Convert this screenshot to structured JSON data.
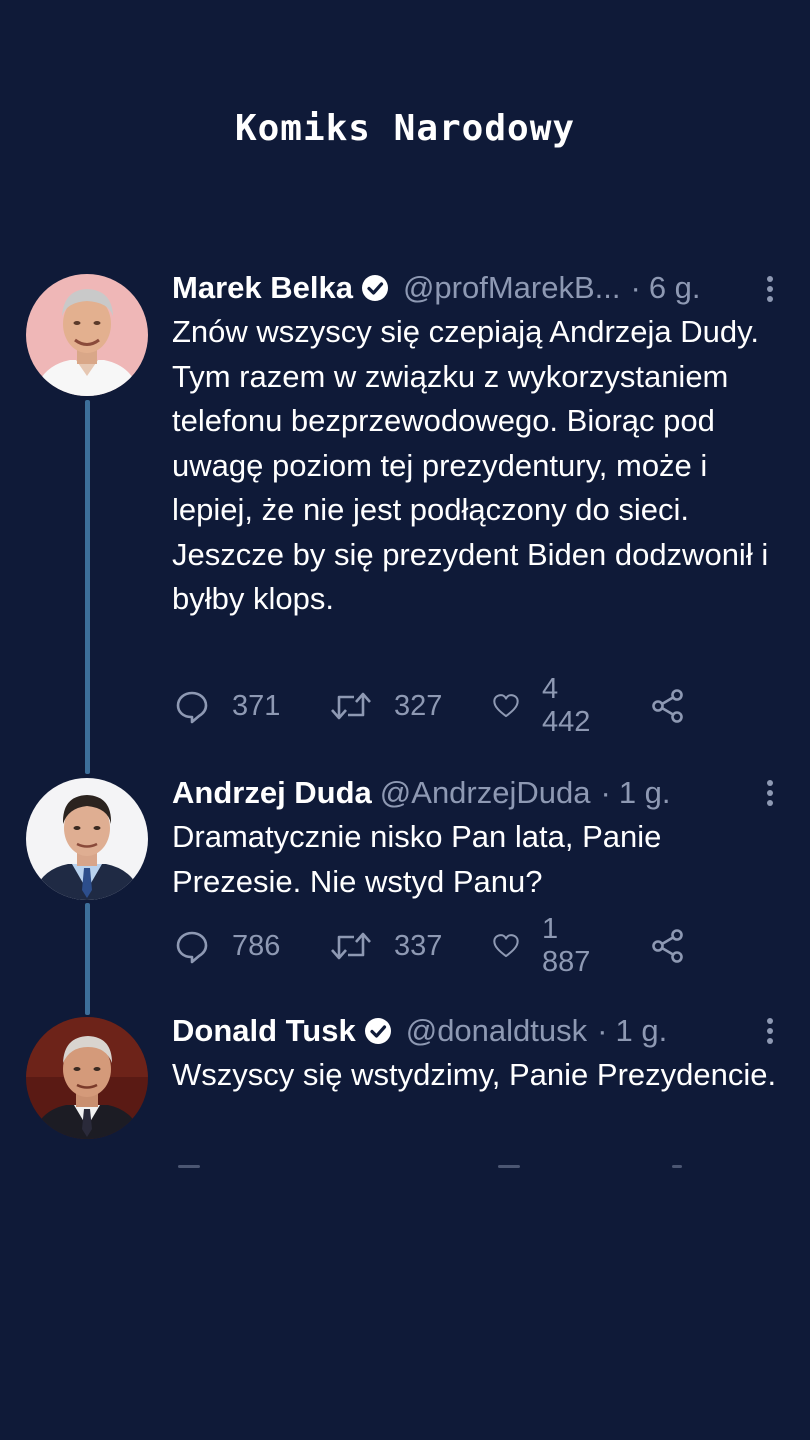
{
  "header": {
    "title": "Komiks Narodowy"
  },
  "tweets": [
    {
      "name": "Marek Belka",
      "verified": true,
      "handle": "@profMarekB...",
      "time": "6 g.",
      "text": "Znów wszyscy się czepiają Andrzeja Dudy. Tym razem w związku z wykorzystaniem telefonu bezprzewodowego. Biorąc pod uwagę poziom tej prezydentury, może i lepiej, że nie jest podłączony do sieci. Jeszcze by się prezydent Biden dodzwonił i byłby klops.",
      "replies": "371",
      "retweets": "327",
      "likes": "4 442"
    },
    {
      "name": "Andrzej Duda",
      "verified": false,
      "handle": "@AndrzejDuda",
      "time": "1 g.",
      "text": "Dramatycznie nisko Pan lata, Panie Prezesie. Nie wstyd Panu?",
      "replies": "786",
      "retweets": "337",
      "likes": "1 887"
    },
    {
      "name": "Donald Tusk",
      "verified": true,
      "handle": "@donaldtusk",
      "time": "1 g.",
      "text": "Wszyscy się wstydzimy, Panie Prezydencie."
    }
  ],
  "icons": {
    "reply": "reply-icon",
    "retweet": "retweet-icon",
    "like": "heart-icon",
    "share": "share-icon",
    "more": "more-vertical-icon",
    "verified": "verified-badge-icon"
  },
  "colors": {
    "background": "#0f1a38",
    "muted": "#8e99b3",
    "thread_line": "#3d6f9a"
  }
}
